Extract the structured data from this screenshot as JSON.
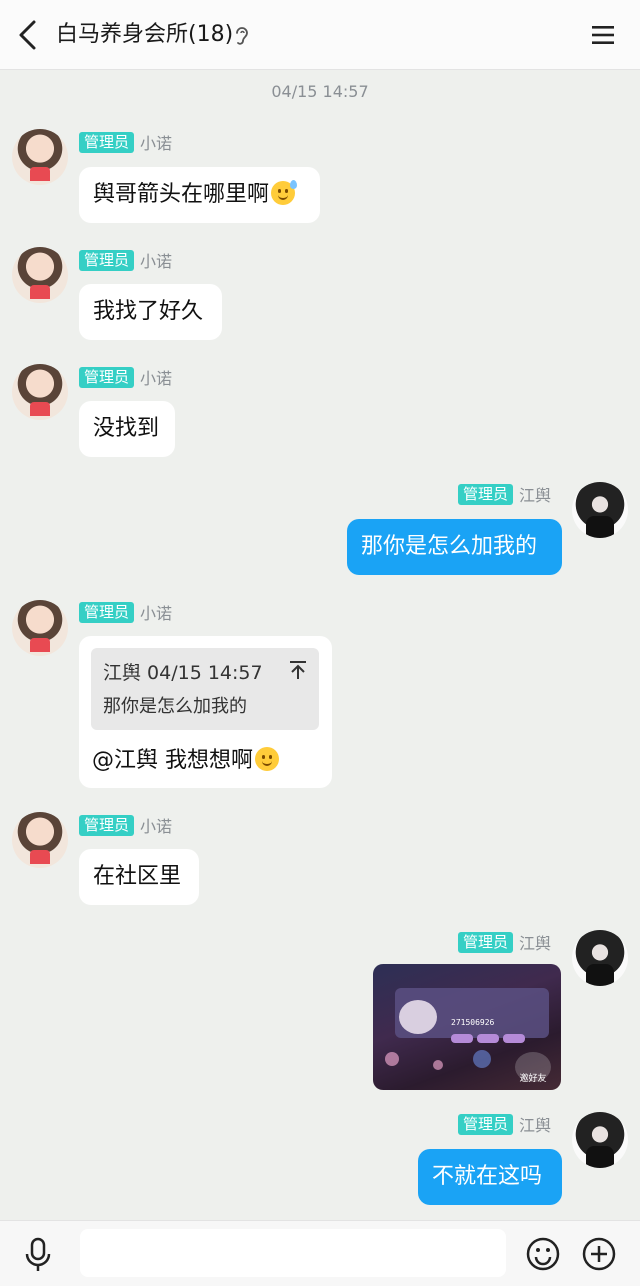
{
  "header": {
    "title": "白马养身会所(18)"
  },
  "timestamp": "04/15 14:57",
  "messages": [
    {
      "badge": "管理员",
      "sender": "小诺",
      "text": "舆哥箭头在哪里啊"
    },
    {
      "badge": "管理员",
      "sender": "小诺",
      "text": "我找了好久"
    },
    {
      "badge": "管理员",
      "sender": "小诺",
      "text": "没找到"
    },
    {
      "badge": "管理员",
      "sender": "江舆",
      "text": "那你是怎么加我的"
    },
    {
      "badge": "管理员",
      "sender": "小诺",
      "quote": {
        "author_time": "江舆 04/15 14:57",
        "text": "那你是怎么加我的"
      },
      "text": "@江舆 我想想啊"
    },
    {
      "badge": "管理员",
      "sender": "小诺",
      "text": "在社区里"
    },
    {
      "badge": "管理员",
      "sender": "江舆",
      "image": {
        "user_id": "271506926",
        "button_label": "邀好友"
      }
    },
    {
      "badge": "管理员",
      "sender": "江舆",
      "text": "不就在这吗"
    }
  ],
  "composer": {
    "placeholder": ""
  },
  "colors": {
    "accent_bubble": "#1aa3f5",
    "badge": "#35cfc5",
    "background": "#eef0ed"
  },
  "icons": [
    "back-icon",
    "ear-icon",
    "menu-icon",
    "mic-icon",
    "emoji-icon",
    "plus-icon",
    "quote-up-icon"
  ]
}
